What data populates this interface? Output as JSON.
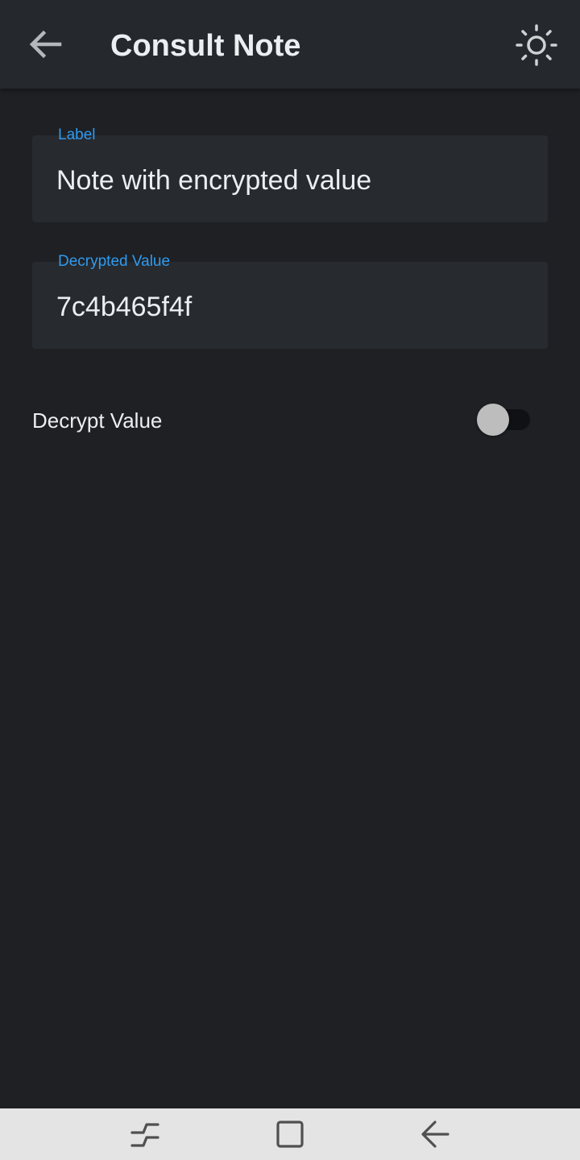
{
  "app_bar": {
    "title": "Consult Note",
    "back_icon": "arrow-left-icon",
    "theme_icon": "sun-icon"
  },
  "fields": [
    {
      "label": "Label",
      "value": "Note with encrypted value"
    },
    {
      "label": "Decrypted Value",
      "value": "7c4b465f4f"
    }
  ],
  "toggle": {
    "label": "Decrypt Value",
    "checked": false
  },
  "nav_bar": {
    "recents_icon": "recents-icon",
    "home_icon": "home-icon",
    "back_icon": "back-icon"
  },
  "colors": {
    "background": "#1e2024",
    "app_bar": "#25282c",
    "field_background": "#272a2e",
    "accent": "#2f9bf0",
    "text": "#eceff1",
    "nav_bar": "#e4e4e4"
  }
}
